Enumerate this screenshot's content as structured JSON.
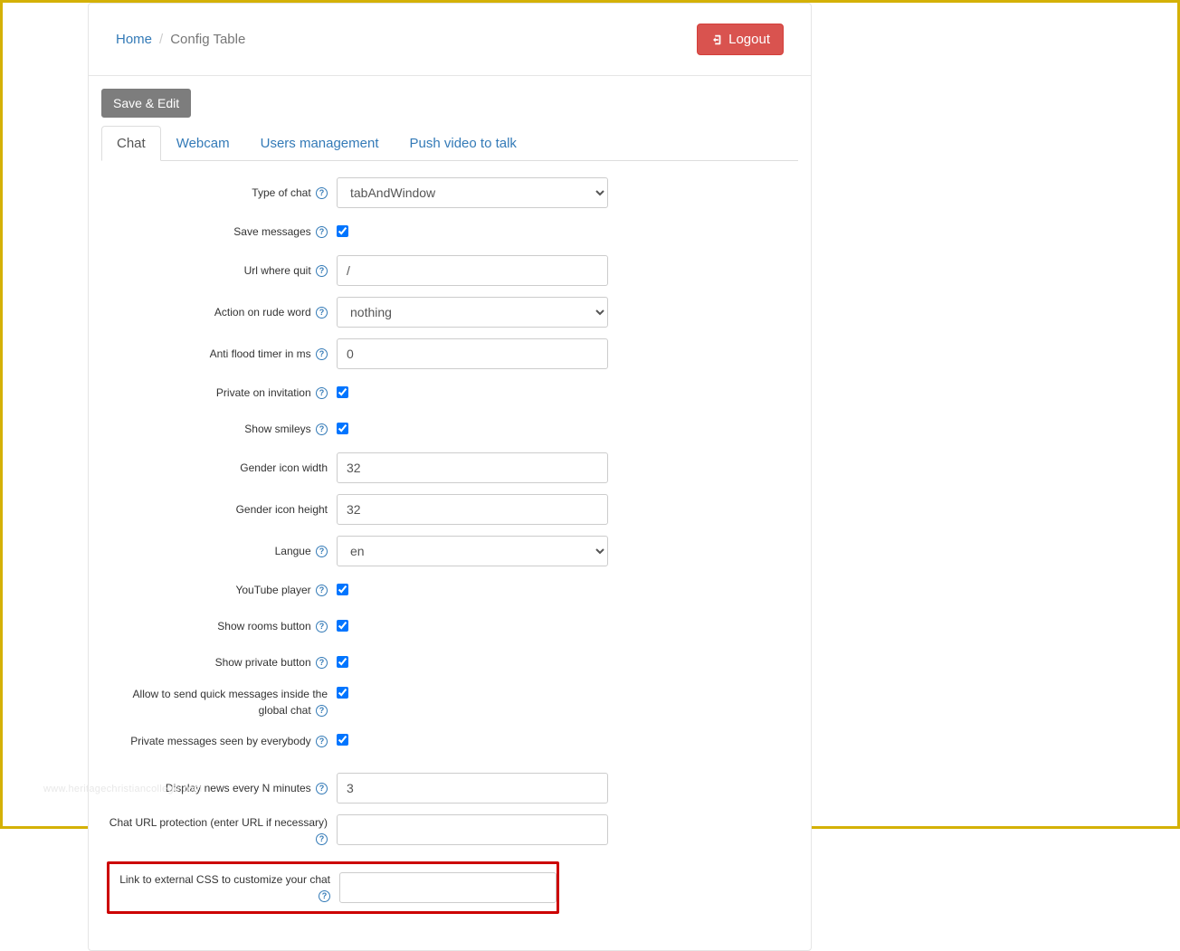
{
  "breadcrumb": {
    "home": "Home",
    "current": "Config Table"
  },
  "logout_label": "Logout",
  "save_edit_label": "Save & Edit",
  "tabs": [
    {
      "label": "Chat"
    },
    {
      "label": "Webcam"
    },
    {
      "label": "Users management"
    },
    {
      "label": "Push video to talk"
    }
  ],
  "form": {
    "type_of_chat": {
      "label": "Type of chat",
      "value": "tabAndWindow"
    },
    "save_messages": {
      "label": "Save messages",
      "checked": true
    },
    "url_where_quit": {
      "label": "Url where quit",
      "value": "/"
    },
    "action_rude_word": {
      "label": "Action on rude word",
      "value": "nothing"
    },
    "anti_flood": {
      "label": "Anti flood timer in ms",
      "value": "0"
    },
    "private_on_invitation": {
      "label": "Private on invitation",
      "checked": true
    },
    "show_smileys": {
      "label": "Show smileys",
      "checked": true
    },
    "gender_icon_width": {
      "label": "Gender icon width",
      "value": "32"
    },
    "gender_icon_height": {
      "label": "Gender icon height",
      "value": "32"
    },
    "langue": {
      "label": "Langue",
      "value": "en"
    },
    "youtube_player": {
      "label": "YouTube player",
      "checked": true
    },
    "show_rooms_button": {
      "label": "Show rooms button",
      "checked": true
    },
    "show_private_button": {
      "label": "Show private button",
      "checked": true
    },
    "quick_messages": {
      "label": "Allow to send quick messages inside the global chat",
      "checked": true
    },
    "private_seen_everybody": {
      "label": "Private messages seen by everybody",
      "checked": true
    },
    "display_news": {
      "label": "Display news every N minutes",
      "value": "3"
    },
    "chat_url_protection": {
      "label": "Chat URL protection (enter URL if necessary)",
      "value": ""
    },
    "external_css": {
      "label": "Link to external CSS to customize your chat",
      "value": ""
    }
  },
  "watermark": "www.heritagechristiancollege.com"
}
